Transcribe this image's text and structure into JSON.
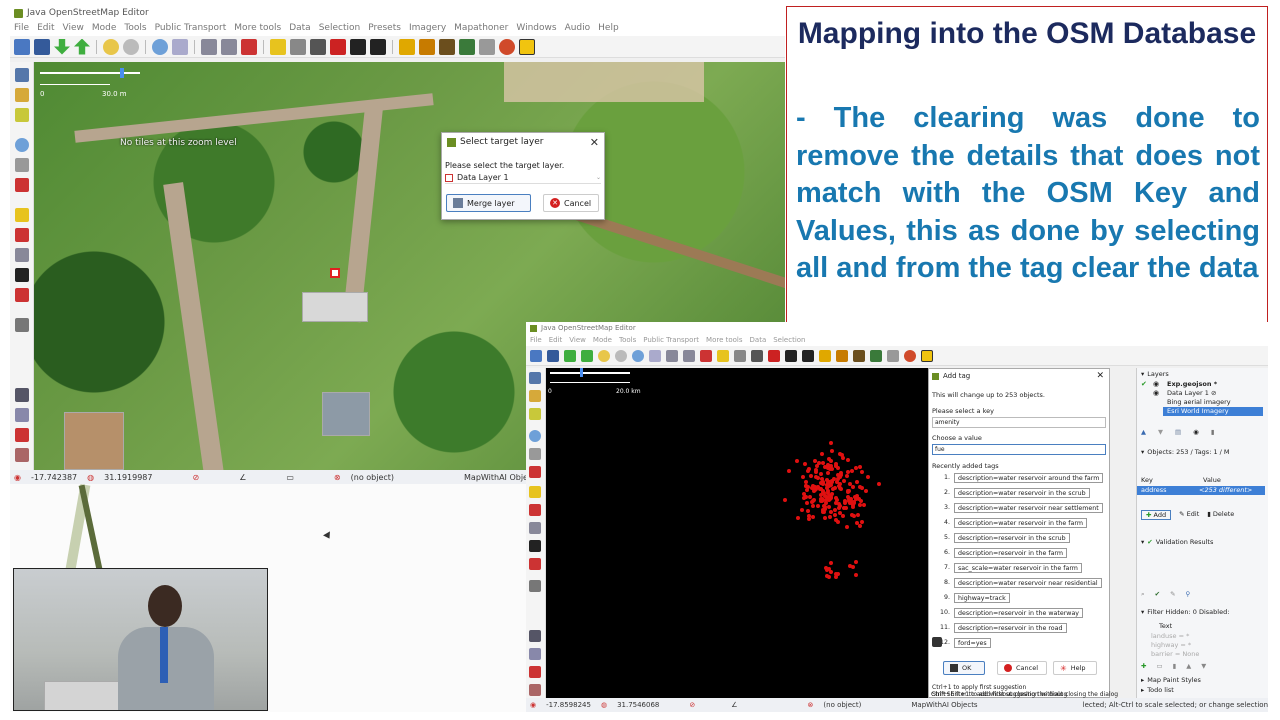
{
  "window1": {
    "title": "Java OpenStreetMap Editor",
    "menu": [
      "File",
      "Edit",
      "View",
      "Mode",
      "Tools",
      "Public Transport",
      "More tools",
      "Data",
      "Selection",
      "Presets",
      "Imagery",
      "Mapathoner",
      "Windows",
      "Audio",
      "Help"
    ],
    "scale_left": "0",
    "scale_right": "30.0 m",
    "no_tiles_text": "No tiles at this zoom level",
    "status": {
      "lat": "-17.742387",
      "lon": "31.1919987",
      "object": "(no object)",
      "plugin": "MapWithAI Objects Added"
    },
    "dialog": {
      "title": "Select target layer",
      "prompt": "Please select the target layer.",
      "selected": "Data Layer 1",
      "merge_label": "Merge layer",
      "cancel_label": "Cancel"
    }
  },
  "slide": {
    "title": "Mapping into the OSM Database",
    "body": "- The clearing was done to remove the details that does not match with the OSM Key and Values, this as done by selecting all and from the tag clear the data"
  },
  "window2": {
    "title": "Java OpenStreetMap Editor",
    "menu": [
      "File",
      "Edit",
      "View",
      "Mode",
      "Tools",
      "Public Transport",
      "More tools",
      "Data",
      "Selection"
    ],
    "scale_left": "0",
    "scale_right": "20.0 km",
    "status": {
      "lat": "-17.8598245",
      "lon": "31.7546068",
      "object": "(no object)",
      "plugin": "MapWithAI Objects",
      "hint": "lected; Alt-Ctrl to scale selected; or change selection"
    },
    "add_tag": {
      "title": "Add tag",
      "info": "This will change up to 253 objects.",
      "key_label": "Please select a key",
      "key_value": "amenity",
      "value_label": "Choose a value",
      "value_value": "fue",
      "recent_label": "Recently added tags",
      "recent": [
        {
          "n": "1.",
          "tag": "description=water reservoir around the farm"
        },
        {
          "n": "2.",
          "tag": "description=water reservoir in the scrub"
        },
        {
          "n": "3.",
          "tag": "description=water reservoir near settlement"
        },
        {
          "n": "4.",
          "tag": "description=water reservoir in the farm"
        },
        {
          "n": "5.",
          "tag": "description=reservoir in the scrub"
        },
        {
          "n": "6.",
          "tag": "description=reservoir in the farm"
        },
        {
          "n": "7.",
          "tag": "sac_scale=water reservoir in the farm"
        },
        {
          "n": "8.",
          "tag": "description=water reservoir near residential"
        },
        {
          "n": "9.",
          "tag": "highway=track"
        },
        {
          "n": "10.",
          "tag": "description=reservoir in the waterway"
        },
        {
          "n": "11.",
          "tag": "description=reservoir in the road"
        },
        {
          "n": "12.",
          "tag": "ford=yes"
        }
      ],
      "ok_label": "OK",
      "cancel_label": "Cancel",
      "help_label": "Help",
      "hint1": "Ctrl+1 to apply first suggestion",
      "hint2": "Shift+Enter to add without closing the dialog",
      "hint3": "Ctrl+Shift+1 to add first suggestion without closing the dialog"
    },
    "layers": {
      "header": "Layers",
      "items": [
        "Exp.geojson *",
        "Data Layer 1 ⊘",
        "Bing aerial imagery",
        "Esri World Imagery"
      ]
    },
    "objects": {
      "header": "Objects: 253 / Tags: 1 / M",
      "col_key": "Key",
      "col_value": "Value",
      "row_key": "address",
      "row_value": "<253 different>",
      "add": "Add",
      "edit": "Edit",
      "delete": "Delete"
    },
    "validation": "Validation Results",
    "filter": {
      "header": "Filter Hidden: 0 Disabled:",
      "col": "Text",
      "items": [
        "landuse = *",
        "highway = *",
        "barrier = None"
      ]
    },
    "map_paint": "Map Paint Styles",
    "todo": "Todo list"
  }
}
